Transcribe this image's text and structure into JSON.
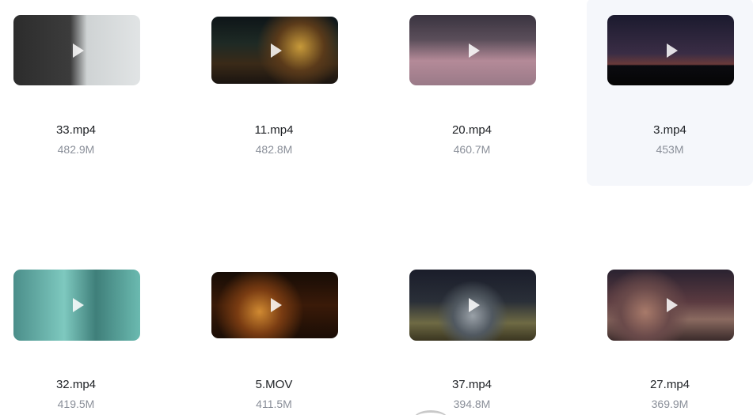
{
  "videos": [
    {
      "name": "33.mp4",
      "size": "482.9M"
    },
    {
      "name": "11.mp4",
      "size": "482.8M"
    },
    {
      "name": "20.mp4",
      "size": "460.7M"
    },
    {
      "name": "3.mp4",
      "size": "453M"
    },
    {
      "name": "32.mp4",
      "size": "419.5M"
    },
    {
      "name": "5.MOV",
      "size": "411.5M"
    },
    {
      "name": "37.mp4",
      "size": "394.8M"
    },
    {
      "name": "27.mp4",
      "size": "369.9M"
    }
  ],
  "icons": {
    "play": "play-icon"
  },
  "colors": {
    "hover_tile_bg": "#f5f7fb",
    "name_text": "#1c1f23",
    "size_text": "#8a8f99"
  }
}
